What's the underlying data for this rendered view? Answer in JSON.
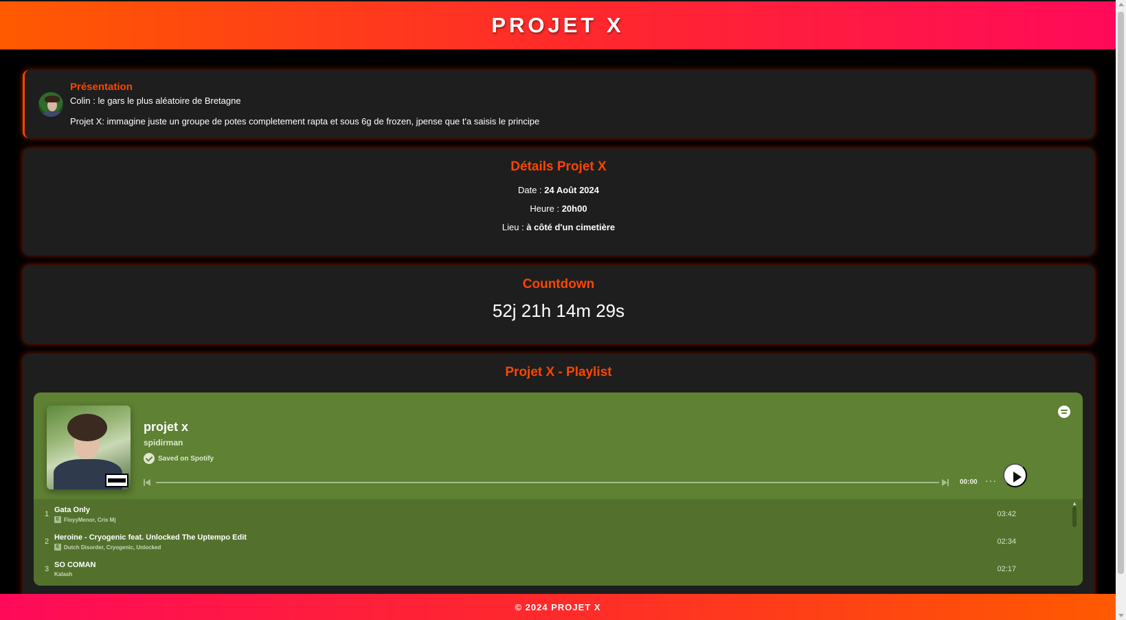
{
  "header": {
    "title": "PROJET X"
  },
  "presentation": {
    "heading": "Présentation",
    "line1": "Colin : le gars le plus aléatoire de Bretagne",
    "line2": "Projet X: immagine juste un groupe de potes completement rapta et sous 6g de frozen, jpense que t'a saisis le principe"
  },
  "details": {
    "heading": "Détails Projet X",
    "date_label": "Date :",
    "date_value": "24 Août 2024",
    "time_label": "Heure :",
    "time_value": "20h00",
    "place_label": "Lieu :",
    "place_value": "à côté d'un cimetière"
  },
  "countdown": {
    "heading": "Countdown",
    "value": "52j 21h 14m 29s"
  },
  "playlist": {
    "heading": "Projet X - Playlist",
    "title": "projet x",
    "owner": "spidirman",
    "saved_label": "Saved on Spotify",
    "current_time": "00:00",
    "more_label": "···",
    "explicit_badge": "E",
    "tracks": [
      {
        "num": "1",
        "title": "Gata Only",
        "artists": "FloyyMenor, Cris Mj",
        "explicit": true,
        "duration": "03:42"
      },
      {
        "num": "2",
        "title": "Heroine - Cryogenic feat. Unlocked The Uptempo Edit",
        "artists": "Dutch Disorder, Cryogenic, Unlocked",
        "explicit": true,
        "duration": "02:34"
      },
      {
        "num": "3",
        "title": "SO COMAN",
        "artists": "Kalash",
        "explicit": false,
        "duration": "02:17"
      }
    ]
  },
  "footer": {
    "text": "© 2024 PROJET X"
  },
  "colors": {
    "accent": "#ff4500",
    "header_gradient_start": "#ff5a00",
    "header_gradient_end": "#ff0a5a",
    "card_bg": "#1e1e1e",
    "spotify_bg": "#5e8133"
  }
}
